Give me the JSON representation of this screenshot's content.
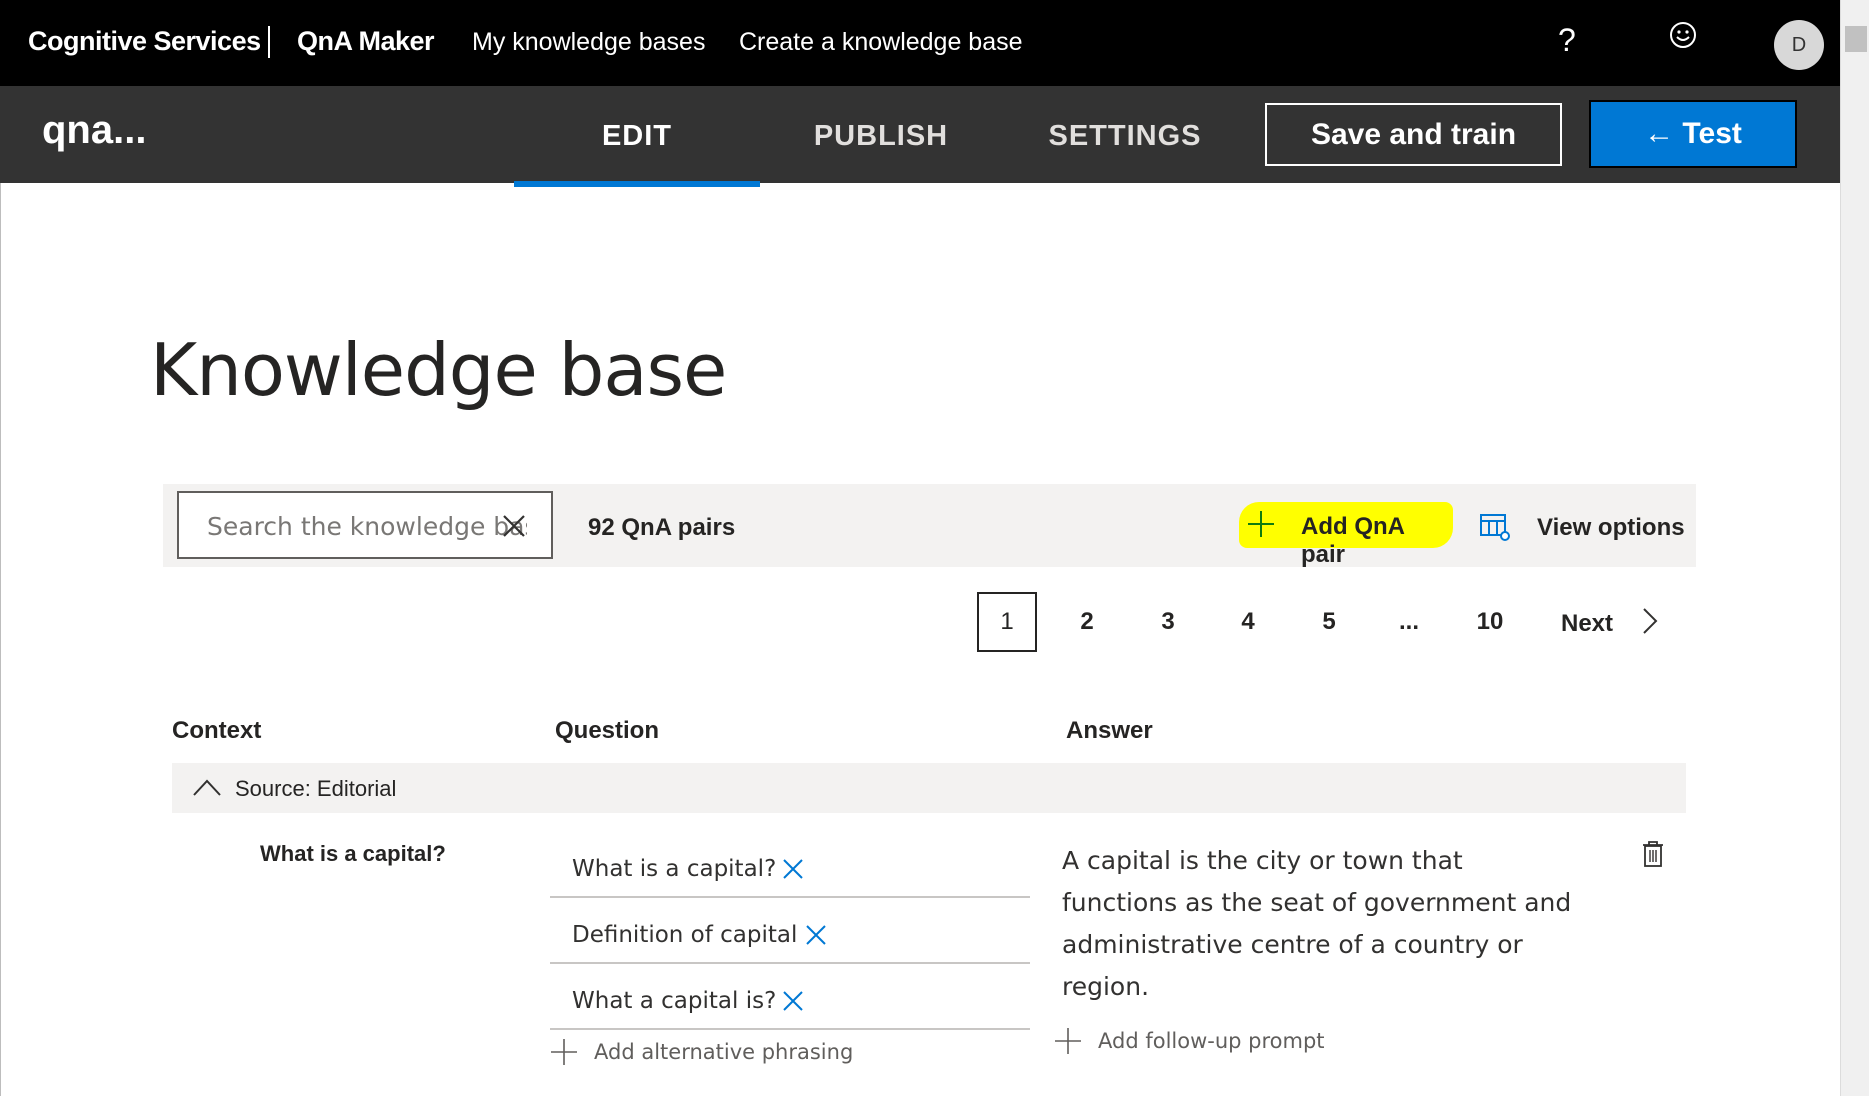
{
  "topnav": {
    "brand": "Cognitive Services",
    "product": "QnA Maker",
    "links": [
      "My knowledge bases",
      "Create a knowledge base"
    ],
    "help_label": "?",
    "avatar_initial": "D"
  },
  "kbbar": {
    "kb_name": "qna...",
    "tabs": [
      "EDIT",
      "PUBLISH",
      "SETTINGS"
    ],
    "active_tab": "EDIT",
    "save_label": "Save and train",
    "test_label": "← Test"
  },
  "page": {
    "title": "Knowledge base"
  },
  "toolbar": {
    "search_placeholder": "Search the knowledge base",
    "pair_count": "92 QnA pairs",
    "add_pair_label": "Add QnA pair",
    "view_options_label": "View options"
  },
  "pager": {
    "pages": [
      "1",
      "2",
      "3",
      "4",
      "5",
      "...",
      "10"
    ],
    "current": "1",
    "next_label": "Next"
  },
  "table": {
    "headers": {
      "context": "Context",
      "question": "Question",
      "answer": "Answer"
    },
    "source_label": "Source: Editorial",
    "rows": [
      {
        "context": "What is a capital?",
        "questions": [
          "What is a capital?",
          "Definition of capital",
          "What a capital is?"
        ],
        "add_alternative_label": "Add alternative phrasing",
        "answer": "A capital is the city or town that functions as the seat of government and administrative centre of a country or region.",
        "add_followup_label": "Add follow-up prompt"
      }
    ]
  },
  "colors": {
    "accent": "#0078d4",
    "highlight": "#ffff00",
    "topnav_bg": "#000000",
    "kbbar_bg": "#333333"
  }
}
